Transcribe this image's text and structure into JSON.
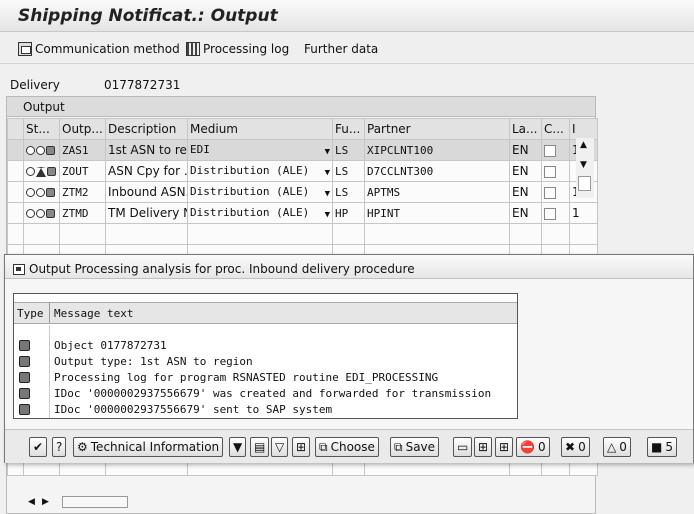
{
  "window": {
    "title": "Shipping Notificat.: Output"
  },
  "toolbar": {
    "communication_method": "Communication method",
    "processing_log": "Processing log",
    "further_data": "Further data"
  },
  "delivery": {
    "label": "Delivery",
    "value": "0177872731"
  },
  "output": {
    "section_title": "Output",
    "columns": [
      "St...",
      "Outp...",
      "Description",
      "Medium",
      "Fu...",
      "Partner",
      "La...",
      "C...",
      "I"
    ],
    "rows": [
      {
        "output": "ZAS1",
        "description": "1st ASN to re...",
        "medium": "EDI",
        "function": "LS",
        "partner": "XIPCLNT100",
        "language": "EN",
        "extra": "1"
      },
      {
        "output": "ZOUT",
        "description": "ASN Cpy for ...",
        "medium": "Distribution (ALE)",
        "function": "LS",
        "partner": "D7CCLNT300",
        "language": "EN",
        "extra": ""
      },
      {
        "output": "ZTM2",
        "description": "Inbound ASN...",
        "medium": "Distribution (ALE)",
        "function": "LS",
        "partner": "APTMS",
        "language": "EN",
        "extra": "1"
      },
      {
        "output": "ZTMD",
        "description": "TM Delivery N...",
        "medium": "Distribution (ALE)",
        "function": "HP",
        "partner": "HPINT",
        "language": "EN",
        "extra": "1"
      }
    ]
  },
  "dialog": {
    "title": "Output Processing analysis for proc. Inbound delivery procedure",
    "col_type": "Type",
    "col_message": "Message text",
    "messages": [
      "Object 0177872731",
      "Output type: 1st ASN to region",
      "Processing log for program RSNASTED routine EDI_PROCESSING",
      "IDoc '0000002937556679' was created and forwarded for transmission",
      "IDoc '0000002937556679' sent to SAP system"
    ],
    "toolbar": {
      "technical_information": "Technical Information",
      "choose": "Choose",
      "save": "Save",
      "count_stop": "0",
      "count_error": "0",
      "count_warning": "0",
      "count_info": "5"
    }
  }
}
